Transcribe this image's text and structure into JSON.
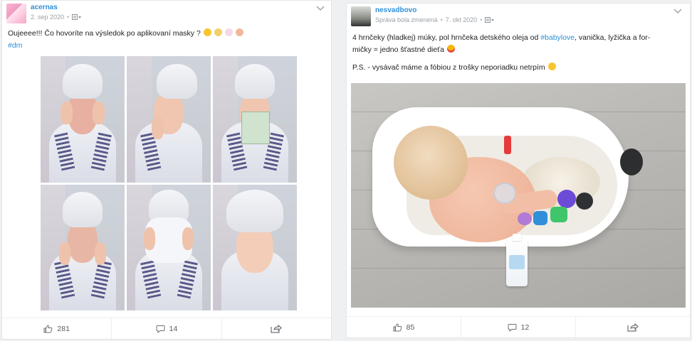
{
  "colors": {
    "link_blue": "#2f8fd8",
    "meta_gray": "#9aa0a6",
    "text": "#222222",
    "emoji_heart_eyes": "#f5b800"
  },
  "posts": [
    {
      "author": "acernas",
      "meta": {
        "date": "2. sep 2020",
        "separator": "•",
        "audience_icon": "group-icon"
      },
      "text_line": "Oujeeee!!! Čo hovoríte na výsledok po aplikovaní masky ?",
      "hashtag": "#dm",
      "emojis": [
        "laughing-emoji",
        "person-emoji",
        "sparkles-emoji",
        "baby-emoji"
      ],
      "photo": {
        "type": "collage",
        "cells": 6
      },
      "actions": {
        "likes": "281",
        "comments": "14",
        "like_icon": "thumbs-up-icon",
        "comment_icon": "comment-icon",
        "share_icon": "share-icon"
      }
    },
    {
      "author": "nesvadbovo",
      "meta": {
        "edited": "Správa bola zmenená",
        "separator": "•",
        "date": "7. okt 2020",
        "audience_icon": "group-icon"
      },
      "text_before_tag": "4 hrnčeky (hladkej) múky, pol hrnčeka detského oleja od ",
      "hashtag": "#babylove",
      "text_after_tag": ", vanička, lyžička a for-",
      "text_line2": "mičky = jedno šťastné dieťa",
      "text_ps": "P.S. - vysávač máme a fóbiou z trošky neporiadku netrpím",
      "emojis": [
        "heart-eyes-emoji",
        "smile-emoji"
      ],
      "photo": {
        "type": "photo"
      },
      "actions": {
        "likes": "85",
        "comments": "12",
        "like_icon": "thumbs-up-icon",
        "comment_icon": "comment-icon",
        "share_icon": "share-icon"
      }
    }
  ]
}
